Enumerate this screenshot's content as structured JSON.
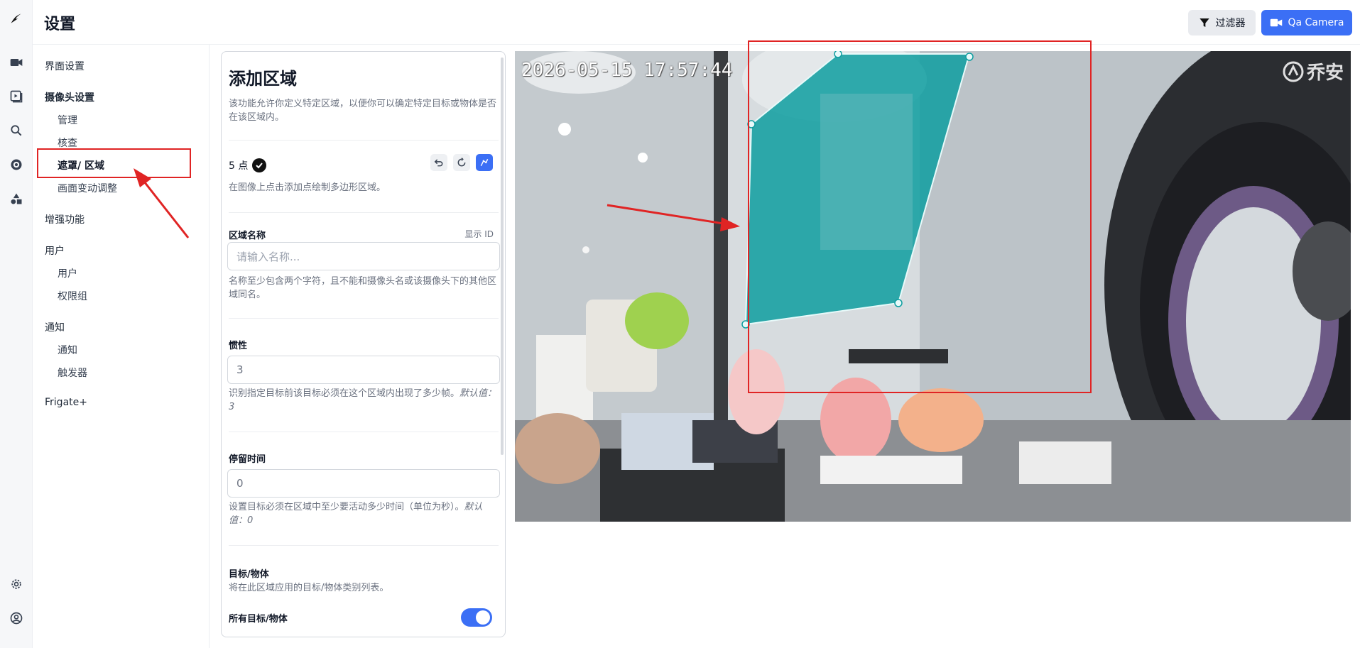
{
  "app": {
    "title": "设置"
  },
  "rail": {
    "items": [
      {
        "icon": "frigate-logo-icon"
      },
      {
        "icon": "video-camera-icon"
      },
      {
        "icon": "playback-icon"
      },
      {
        "icon": "search-icon"
      },
      {
        "icon": "target-icon"
      },
      {
        "icon": "shapes-icon"
      },
      {
        "icon": "gear-icon"
      },
      {
        "icon": "user-icon"
      }
    ]
  },
  "header": {
    "filter_label": "过滤器",
    "camera_label": "Qa Camera"
  },
  "nav": {
    "ui_settings": "界面设置",
    "camera_settings": "摄像头设置",
    "manage": "管理",
    "review": "核查",
    "masks_zones": "遮罩/ 区域",
    "motion_tuner": "画面变动调整",
    "enrichments": "增强功能",
    "users_group": "用户",
    "users": "用户",
    "roles": "权限组",
    "notifications_group": "通知",
    "notifications": "通知",
    "triggers": "触发器",
    "frigate_plus": "Frigate+"
  },
  "panel": {
    "title": "添加区域",
    "description": "该功能允许你定义特定区域，以便你可以确定特定目标或物体是否在该区域内。",
    "points_label": "5 点",
    "points_hint": "在图像上点击添加点绘制多边形区域。",
    "name_label": "区域名称",
    "show_id": "显示 ID",
    "name_placeholder": "请输入名称...",
    "name_hint": "名称至少包含两个字符，且不能和摄像头名或该摄像头下的其他区域同名。",
    "inertia_label": "惯性",
    "inertia_value": "3",
    "inertia_hint": "识别指定目标前该目标必须在这个区域内出现了多少帧。",
    "inertia_default": "默认值：3",
    "loiter_label": "停留时间",
    "loiter_value": "0",
    "loiter_hint": "设置目标必须在区域中至少要活动多少时间（单位为秒）。",
    "loiter_default": "默认值：0",
    "objects_label": "目标/物体",
    "objects_hint": "将在此区域应用的目标/物体类别列表。",
    "all_objects_label": "所有目标/物体",
    "all_objects_enabled": true
  },
  "camera": {
    "timestamp": "2026-05-15 17:57:44",
    "watermark": "乔安",
    "zone_fill": "#0e9ea0"
  },
  "colors": {
    "accent": "#3b6ff5",
    "annotation": "#e02424"
  }
}
